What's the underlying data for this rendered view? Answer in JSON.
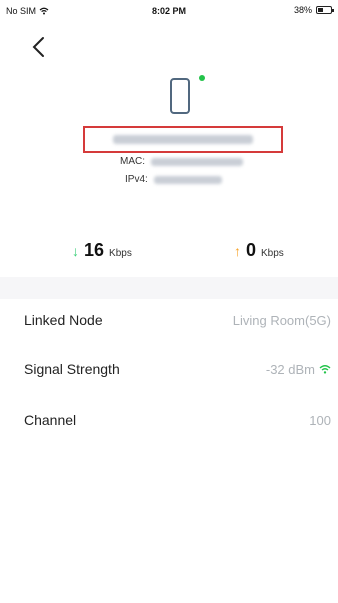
{
  "status_bar": {
    "carrier": "No SIM",
    "time": "8:02 PM",
    "battery": "38%",
    "battery_level": 0.38
  },
  "device": {
    "mac_label": "MAC:",
    "ipv4_label": "IPv4:"
  },
  "speeds": {
    "download": {
      "value": "16",
      "unit": "Kbps"
    },
    "upload": {
      "value": "0",
      "unit": "Kbps"
    }
  },
  "details": {
    "linked_node": {
      "label": "Linked Node",
      "value": "Living Room(5G)"
    },
    "signal_strength": {
      "label": "Signal Strength",
      "value": "-32 dBm"
    },
    "channel": {
      "label": "Channel",
      "value": "100"
    }
  },
  "colors": {
    "online": "#23c34a",
    "download_arrow": "#3ccf7a",
    "upload_arrow": "#f7a226",
    "highlight_box": "#d53a3a",
    "wifi": "#23c34a"
  }
}
